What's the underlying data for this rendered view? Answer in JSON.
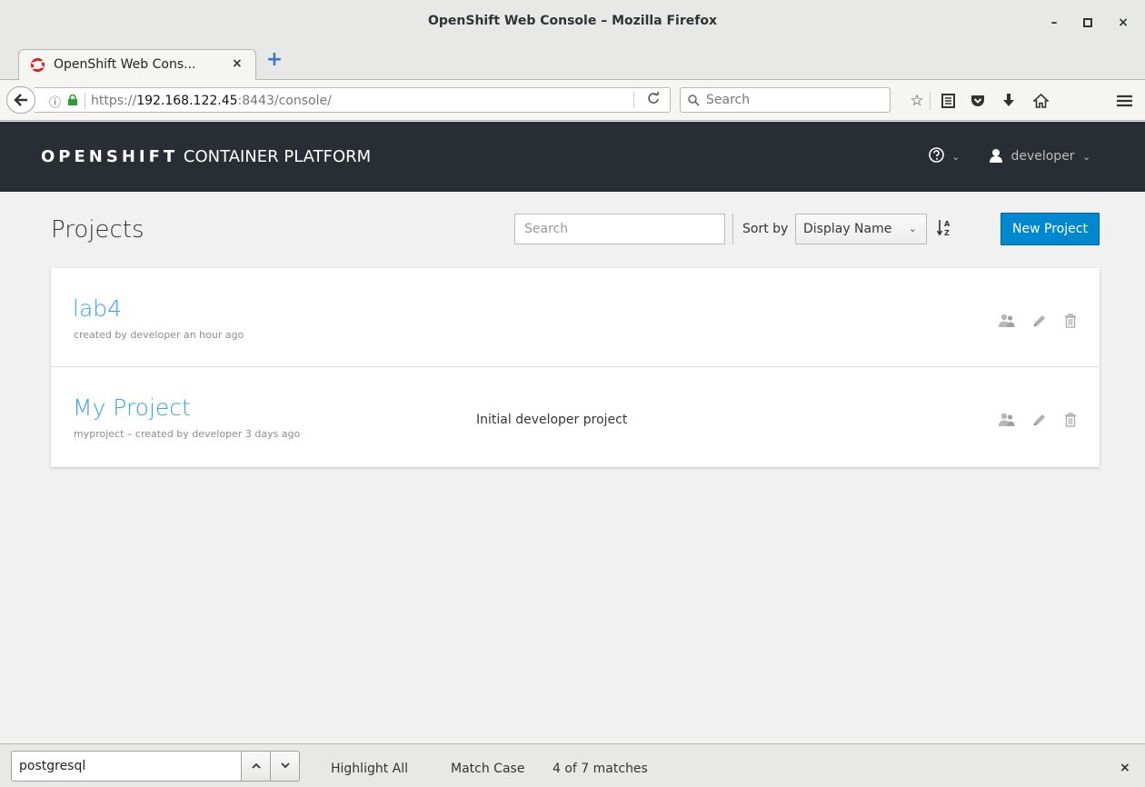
{
  "window": {
    "title": "OpenShift Web Console – Mozilla Firefox",
    "minimize": "–",
    "maximize": "□",
    "close": "×"
  },
  "browser": {
    "tab_title": "OpenShift Web Cons...",
    "tab_close": "×",
    "new_tab": "+",
    "url_prefix": "https://",
    "url_host": "192.168.122.45",
    "url_rest": ":8443/console/",
    "reload": "C",
    "search_placeholder": "Search",
    "toolbar_icons": [
      "bookmark-star-icon",
      "reading-list-icon",
      "pocket-icon",
      "downloads-icon",
      "home-icon",
      "menu-icon"
    ]
  },
  "masthead": {
    "brand_bold": "OPENSHIFT",
    "brand_rest": "CONTAINER PLATFORM",
    "help_chevron": "⌄",
    "user": "developer"
  },
  "page": {
    "title": "Projects",
    "filter_placeholder": "Search",
    "sort_label": "Sort by",
    "sort_value": "Display Name",
    "new_project": "New Project"
  },
  "projects": [
    {
      "name": "lab4",
      "meta": "created by developer an hour ago",
      "description": ""
    },
    {
      "name": "My Project",
      "meta": "myproject – created by developer 3 days ago",
      "description": "Initial developer project"
    }
  ],
  "findbar": {
    "query": "postgresql",
    "highlight_all": "Highlight All",
    "match_case": "Match Case",
    "matches": "4 of 7 matches",
    "close": "×"
  },
  "colors": {
    "masthead_bg": "#292e34",
    "link_blue": "#39a5dc",
    "primary_button": "#0088ce",
    "content_bg": "#f1f1f1"
  }
}
